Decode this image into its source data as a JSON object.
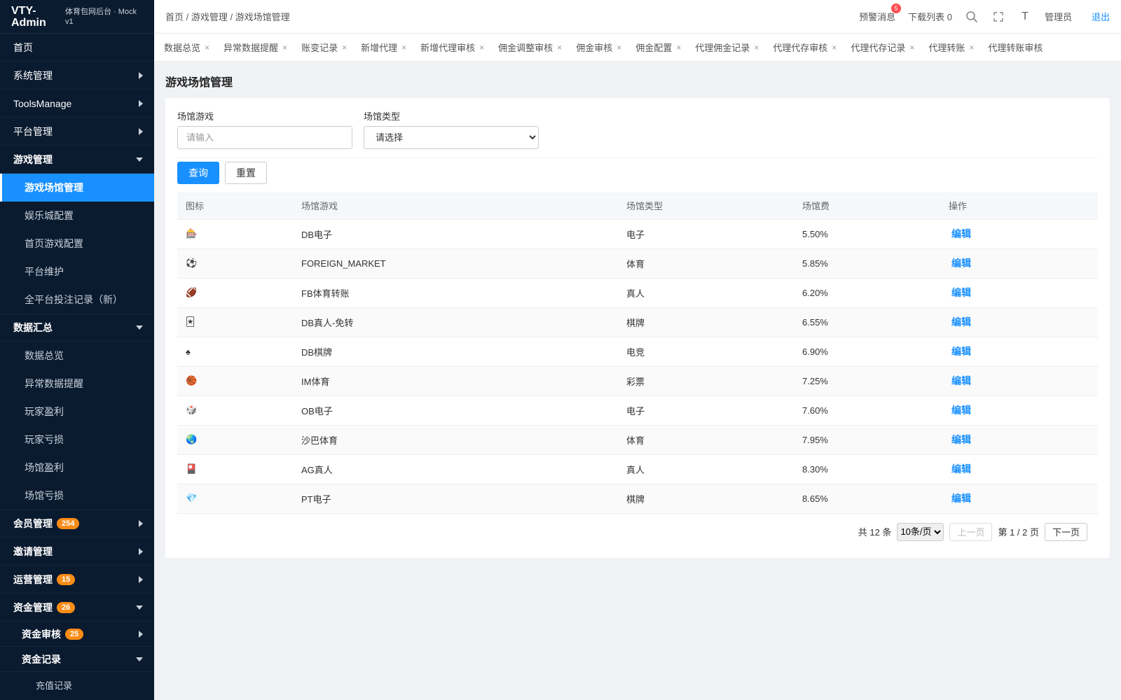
{
  "brand": {
    "title": "VTY-Admin",
    "subtitle": "体育包网后台 · Mock v1"
  },
  "sidebar": {
    "home": "首页",
    "system": "系统管理",
    "tools": "ToolsManage",
    "platform": "平台管理",
    "game": {
      "label": "游戏管理",
      "items": [
        "游戏场馆管理",
        "娱乐城配置",
        "首页游戏配置",
        "平台维护",
        "全平台投注记录（新）"
      ]
    },
    "data": {
      "label": "数据汇总",
      "items": [
        "数据总览",
        "异常数据提醒",
        "玩家盈利",
        "玩家亏损",
        "场馆盈利",
        "场馆亏损"
      ]
    },
    "member": {
      "label": "会员管理",
      "badge": "254"
    },
    "invite": "邀请管理",
    "ops": {
      "label": "运营管理",
      "badge": "15"
    },
    "funds": {
      "label": "资金管理",
      "badge": "26",
      "audit": {
        "label": "资金审核",
        "badge": "25"
      },
      "records": {
        "label": "资金记录",
        "items": [
          "充值记录"
        ]
      }
    }
  },
  "header": {
    "breadcrumb": "首页 / 游戏管理 / 游戏场馆管理",
    "alerts": "预警消息",
    "alerts_badge": "5",
    "downloads": "下载列表 0",
    "font_icon": "T",
    "user": "管理员",
    "logout": "退出"
  },
  "tabs": [
    "数据总览",
    "异常数据提醒",
    "账变记录",
    "新增代理",
    "新增代理审核",
    "佣金调整审核",
    "佣金审核",
    "佣金配置",
    "代理佣金记录",
    "代理代存审核",
    "代理代存记录",
    "代理转账",
    "代理转账审核"
  ],
  "tab_close": "×",
  "page": {
    "title": "游戏场馆管理"
  },
  "filters": {
    "venue_label": "场馆游戏",
    "venue_placeholder": "请输入",
    "type_label": "场馆类型",
    "type_selected": "请选择"
  },
  "buttons": {
    "query": "查询",
    "reset": "重置"
  },
  "table": {
    "columns": [
      "图标",
      "场馆游戏",
      "场馆类型",
      "场馆费",
      "操作"
    ],
    "edit_label": "编辑",
    "rows": [
      {
        "icon": "🎰",
        "name": "DB电子",
        "type": "电子",
        "fee": "5.50%"
      },
      {
        "icon": "⚽",
        "name": "FOREIGN_MARKET",
        "type": "体育",
        "fee": "5.85%"
      },
      {
        "icon": "🏈",
        "name": "FB体育转账",
        "type": "真人",
        "fee": "6.20%"
      },
      {
        "icon": "🃏",
        "name": "DB真人-免转",
        "type": "棋牌",
        "fee": "6.55%"
      },
      {
        "icon": "♠",
        "name": "DB棋牌",
        "type": "电竞",
        "fee": "6.90%"
      },
      {
        "icon": "🏀",
        "name": "IM体育",
        "type": "彩票",
        "fee": "7.25%"
      },
      {
        "icon": "🎲",
        "name": "OB电子",
        "type": "电子",
        "fee": "7.60%"
      },
      {
        "icon": "🌏",
        "name": "沙巴体育",
        "type": "体育",
        "fee": "7.95%"
      },
      {
        "icon": "🎴",
        "name": "AG真人",
        "type": "真人",
        "fee": "8.30%"
      },
      {
        "icon": "💎",
        "name": "PT电子",
        "type": "棋牌",
        "fee": "8.65%"
      }
    ]
  },
  "pager": {
    "total": "共 12 条",
    "page_size": "10条/页",
    "prev": "上一页",
    "page_info": "第 1 / 2 页",
    "next": "下一页"
  }
}
